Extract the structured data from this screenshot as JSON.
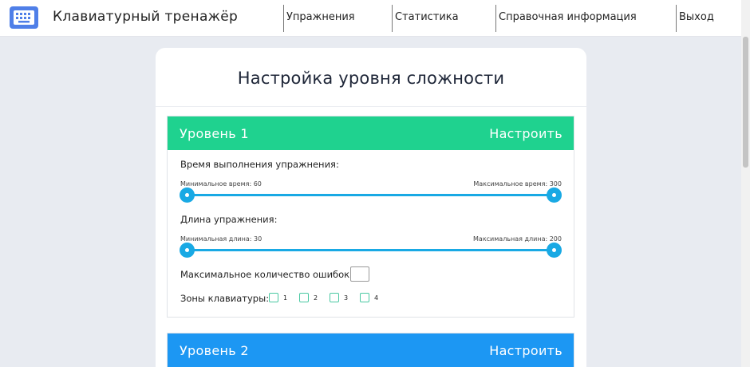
{
  "app": {
    "title": "Клавиатурный тренажёр",
    "logo_icon": "keyboard-icon"
  },
  "nav": [
    {
      "label": "Упражнения"
    },
    {
      "label": "Статистика"
    },
    {
      "label": "Справочная информация"
    },
    {
      "label": "Выход"
    }
  ],
  "page": {
    "title": "Настройка уровня сложности"
  },
  "colors": {
    "level1": "#1fd28f",
    "level2": "#1c97f3",
    "accent": "#19a9e4"
  },
  "levels": [
    {
      "name": "Уровень 1",
      "configure_label": "Настроить",
      "time": {
        "label": "Время выполнения упражнения:",
        "min_label": "Минимальное время: 60",
        "max_label": "Максимальное время: 300"
      },
      "length": {
        "label": "Длина упражнения:",
        "min_label": "Минимальная длина: 30",
        "max_label": "Максимальная длина: 200"
      },
      "max_errors_label": "Максимальное количество ошибок:",
      "max_errors_value": "",
      "zones_label": "Зоны клавиатуры:",
      "zones": [
        "1",
        "2",
        "3",
        "4"
      ]
    },
    {
      "name": "Уровень 2",
      "configure_label": "Настроить"
    }
  ]
}
